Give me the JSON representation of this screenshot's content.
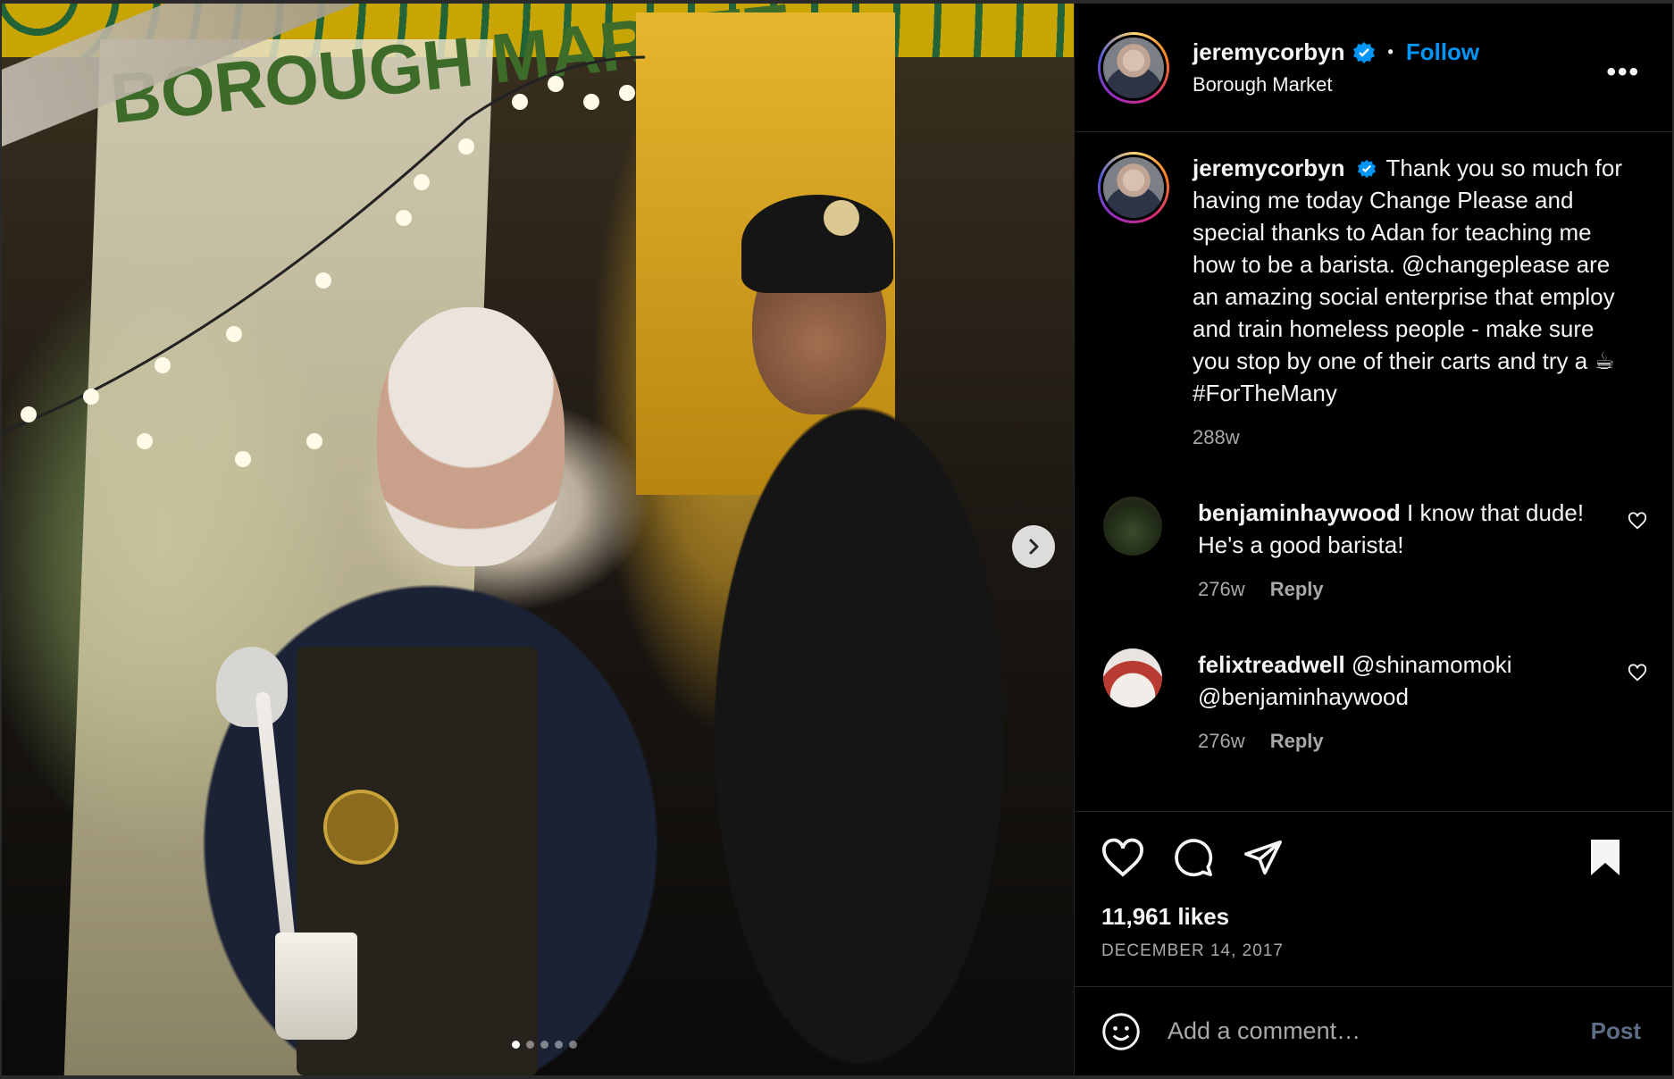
{
  "post": {
    "author": "jeremycorbyn",
    "follow_label": "Follow",
    "separator": "•",
    "location": "Borough Market",
    "more_label": "•••",
    "caption_text": "Thank you so much for having me today Change Please and special thanks to Adan for teaching me how to be a barista. @changeplease are an amazing social enterprise that employ and train homeless people - make sure you stop by one of their carts and try a ☕ #ForTheMany",
    "caption_age": "288w",
    "likes": "11,961 likes",
    "date": "DECEMBER 14, 2017"
  },
  "photo": {
    "board_text": "BOROUGH MARKET",
    "carousel_count": 5,
    "carousel_active": 1
  },
  "comments": [
    {
      "user": "benjaminhaywood",
      "text": "I know that dude! He's a good barista!",
      "age": "276w",
      "reply": "Reply"
    },
    {
      "user": "felixtreadwell",
      "text": "@shinamomoki @benjaminhaywood",
      "age": "276w",
      "reply": "Reply"
    }
  ],
  "composer": {
    "placeholder": "Add a comment…",
    "post_label": "Post"
  },
  "icons": [
    "verified-badge-icon",
    "more-options-icon",
    "chevron-right-icon",
    "heart-icon",
    "comment-icon",
    "share-icon",
    "bookmark-icon",
    "emoji-icon"
  ],
  "colors": {
    "background": "#000000",
    "accent": "#0095f6",
    "muted": "#a8a8a8",
    "post_disabled": "#5c6d85"
  }
}
